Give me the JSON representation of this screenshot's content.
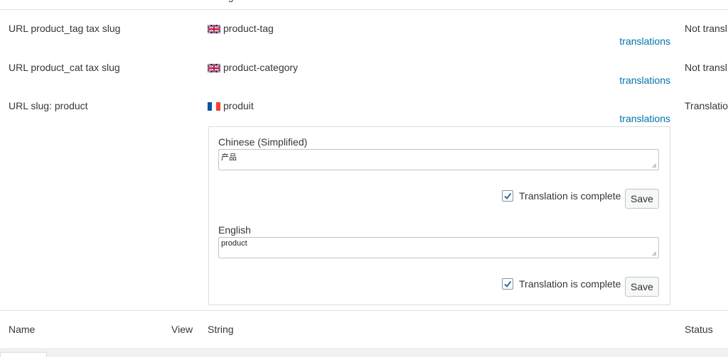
{
  "columns": {
    "name": "Name",
    "view": "View",
    "string": "String",
    "status": "Status"
  },
  "rows": [
    {
      "name": "URL product_tag tax slug",
      "flag": "uk-flag",
      "value": "product-tag",
      "link": "translations",
      "status": "Not transl"
    },
    {
      "name": "URL product_cat tax slug",
      "flag": "uk-flag",
      "value": "product-category",
      "link": "translations",
      "status": "Not transl"
    },
    {
      "name": "URL slug: product",
      "flag": "fr-flag",
      "value": "produit",
      "link": "translations",
      "status": "Translatio"
    }
  ],
  "translations": [
    {
      "language": "Chinese (Simplified)",
      "value": "产品",
      "complete_label": "Translation is complete",
      "complete": true,
      "save_label": "Save"
    },
    {
      "language": "English",
      "value": "product",
      "complete_label": "Translation is complete",
      "complete": true,
      "save_label": "Save"
    }
  ],
  "colors": {
    "link": "#0073aa",
    "checkbox": "#2271b1"
  }
}
